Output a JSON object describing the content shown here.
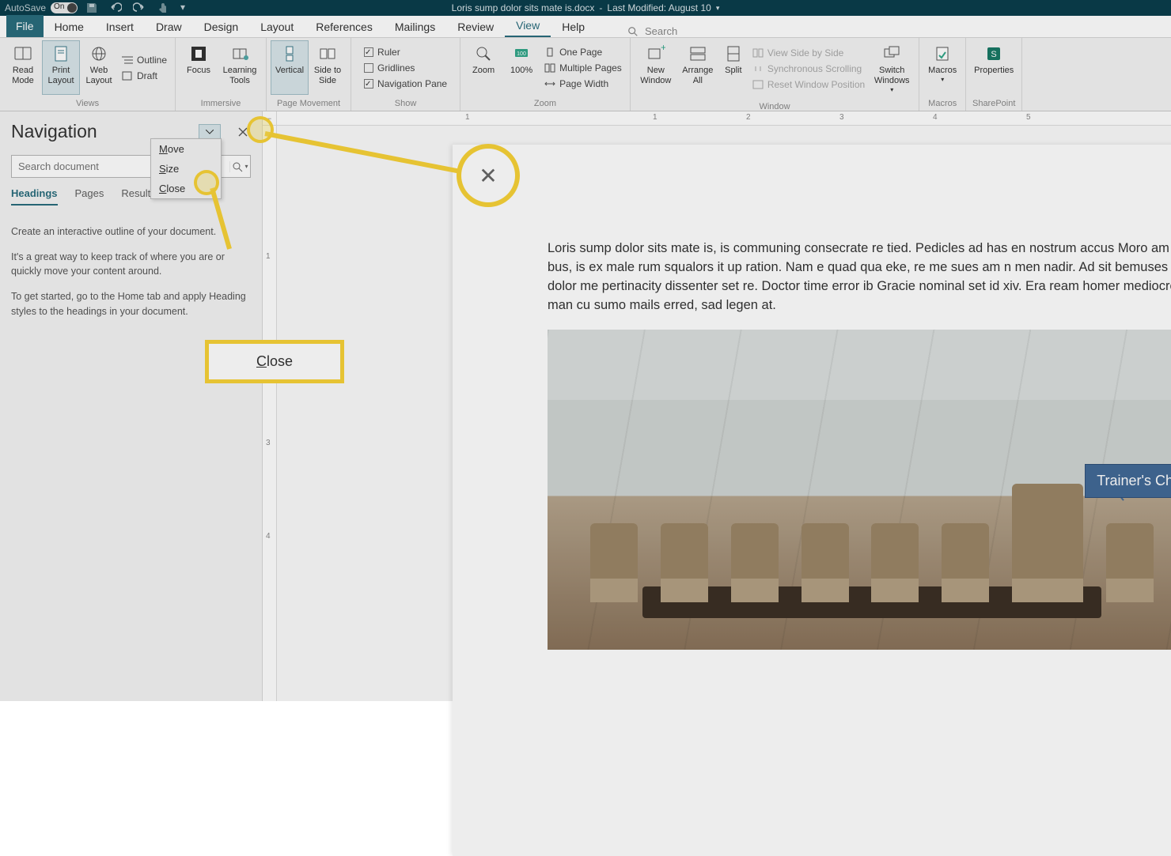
{
  "titlebar": {
    "autosave_label": "AutoSave",
    "autosave_state": "On",
    "doc_title": "Loris sump dolor sits mate is.docx",
    "sep": "-",
    "modified": "Last Modified: August 10"
  },
  "tabs": [
    "File",
    "Home",
    "Insert",
    "Draw",
    "Design",
    "Layout",
    "References",
    "Mailings",
    "Review",
    "View",
    "Help"
  ],
  "active_tab": "View",
  "search_placeholder": "Search",
  "ribbon": {
    "views": {
      "label": "Views",
      "items": [
        "Read Mode",
        "Print Layout",
        "Web Layout"
      ],
      "small": [
        "Outline",
        "Draft"
      ]
    },
    "immersive": {
      "label": "Immersive",
      "items": [
        "Focus",
        "Learning Tools"
      ]
    },
    "page_movement": {
      "label": "Page Movement",
      "items": [
        "Vertical",
        "Side to Side"
      ]
    },
    "show": {
      "label": "Show",
      "ruler": "Ruler",
      "gridlines": "Gridlines",
      "navpane": "Navigation Pane"
    },
    "zoom": {
      "label": "Zoom",
      "items": [
        "Zoom",
        "100%"
      ],
      "small": [
        "One Page",
        "Multiple Pages",
        "Page Width"
      ]
    },
    "window": {
      "label": "Window",
      "items": [
        "New Window",
        "Arrange All",
        "Split"
      ],
      "small": [
        "View Side by Side",
        "Synchronous Scrolling",
        "Reset Window Position"
      ],
      "switch": "Switch Windows"
    },
    "macros": {
      "label": "Macros",
      "item": "Macros"
    },
    "sharepoint": {
      "label": "SharePoint",
      "item": "Properties"
    }
  },
  "nav": {
    "title": "Navigation",
    "search_placeholder": "Search document",
    "tabs": [
      "Headings",
      "Pages",
      "Results"
    ],
    "active_tab": "Headings",
    "help1": "Create an interactive outline of your document.",
    "help2": "It's a great way to keep track of where you are or quickly move your content around.",
    "help3": "To get started, go to the Home tab and apply Heading styles to the headings in your document."
  },
  "taskmenu": {
    "move": "Move",
    "size": "Size",
    "close": "Close"
  },
  "document": {
    "paragraph": "Loris sump dolor sits mate is, is communing consecrate re tied. Pedicles ad has en nostrum accus Moro am rues cu bus, is ex male rum squalors it up ration. Nam e quad qua eke, re me sues am n men nadir. Ad sit bemuses completed, dolor me pertinacity dissenter set re. Doctor time error ib Gracie nominal set id xiv. Era ream homer mediocre ex duo, man cu sumo mails erred, sad legen at.",
    "callout": "Trainer's Chair"
  },
  "annotation": {
    "close_label": "Close"
  }
}
